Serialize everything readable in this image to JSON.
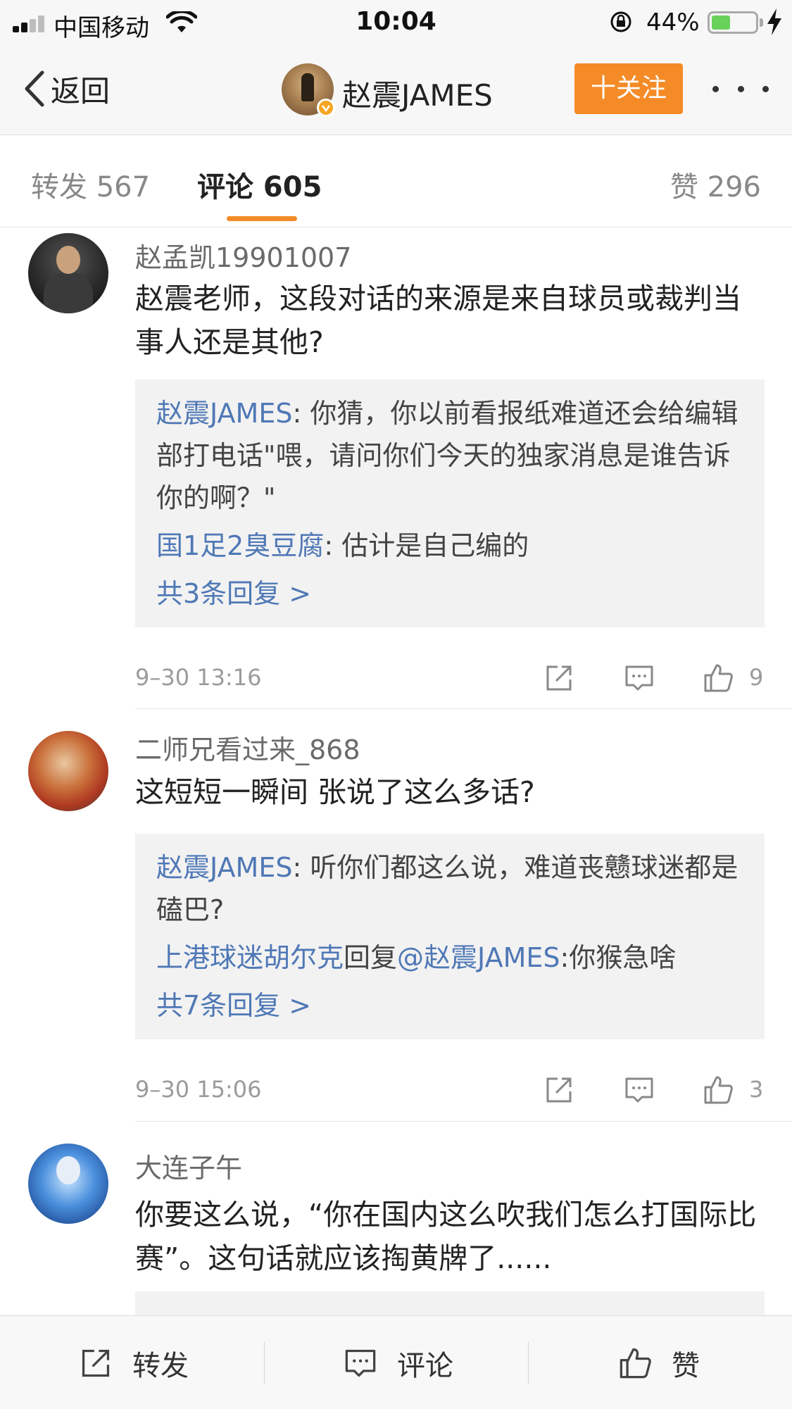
{
  "status_bar": {
    "carrier": "中国移动",
    "time": "10:04",
    "battery_percent": "44%",
    "battery_level": 0.44
  },
  "nav": {
    "back_label": "返回",
    "title": "赵震JAMES",
    "follow_label": "十关注"
  },
  "tabs": {
    "repost": "转发 567",
    "comment": "评论 605",
    "like": "赞 296"
  },
  "comments": [
    {
      "username": "赵孟凯19901007",
      "text": "赵震老师，这段对话的来源是来自球员或裁判当事人还是其他?",
      "replies": [
        {
          "name": "赵震JAMES",
          "sep": ": ",
          "text": "你猜，你以前看报纸难道还会给编辑部打电话\"喂，请问你们今天的独家消息是谁告诉你的啊？\""
        },
        {
          "name": "国1足2臭豆腐",
          "sep": ": ",
          "text": "估计是自己编的"
        }
      ],
      "more_replies": "共3条回复 >",
      "time": "9–30 13:16",
      "likes": "9"
    },
    {
      "username": "二师兄看过来_868",
      "text": "这短短一瞬间 张说了这么多话?",
      "replies": [
        {
          "name": "赵震JAMES",
          "sep": ": ",
          "text": "听你们都这么说，难道丧戆球迷都是磕巴?"
        },
        {
          "name": "上港球迷胡尔克",
          "mid": "回复",
          "mention": "@赵震JAMES",
          "sep": ":",
          "text": "你猴急啥"
        }
      ],
      "more_replies": "共7条回复 >",
      "time": "9–30 15:06",
      "likes": "3"
    },
    {
      "username": "大连子午",
      "text": "你要这么说，“你在国内这么吹我们怎么打国际比赛”。这句话就应该掏黄牌了......"
    }
  ],
  "bottom_bar": {
    "repost": "转发",
    "comment": "评论",
    "like": "赞"
  },
  "colors": {
    "accent": "#f48b27",
    "link": "#4f78b6",
    "battery": "#67d15a"
  }
}
